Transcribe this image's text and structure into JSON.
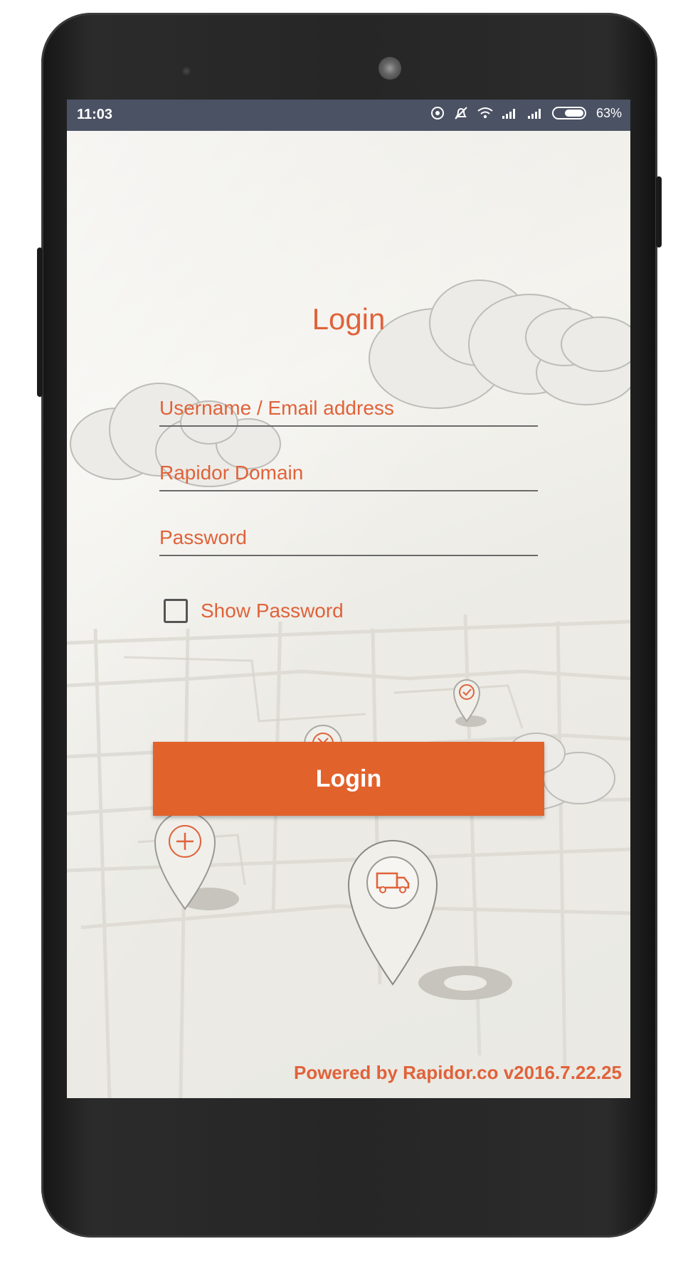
{
  "status_bar": {
    "time": "11:03",
    "battery": "63%",
    "icons": [
      "hotspot-icon",
      "mute-icon",
      "wifi-icon",
      "signal-1-icon",
      "signal-2-icon",
      "battery-icon"
    ]
  },
  "login": {
    "title": "Login",
    "username_placeholder": "Username / Email address",
    "domain_placeholder": "Rapidor Domain",
    "password_placeholder": "Password",
    "show_password_label": "Show Password",
    "button_label": "Login"
  },
  "footer": {
    "powered_by": "Powered by Rapidor.co v2016.7.22.25"
  },
  "colors": {
    "accent": "#e2622c",
    "text_accent": "#e0623a",
    "status_bar": "#4b5264",
    "background": "#eceae4"
  },
  "decor_icons": [
    "cloud-icon",
    "map-roads",
    "pin-check-icon",
    "pin-cancel-icon",
    "pin-add-icon",
    "pin-truck-icon"
  ]
}
